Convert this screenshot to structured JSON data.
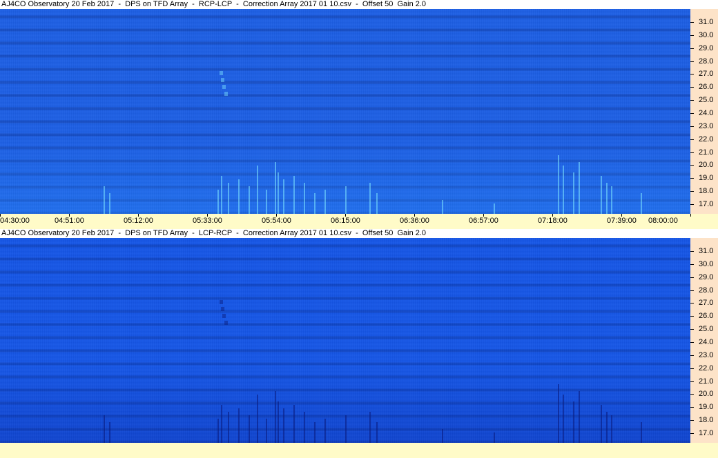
{
  "panels": [
    {
      "title": "AJ4CO Observatory 20 Feb 2017  -  DPS on TFD Array  -  RCP-LCP  -  Correction Array 2017 01 10.csv  -  Offset 50  Gain 2.0"
    },
    {
      "title": "AJ4CO Observatory 20 Feb 2017  -  DPS on TFD Array  -  LCP-RCP  -  Correction Array 2017 01 10.csv  -  Offset 50  Gain 2.0"
    }
  ],
  "freq_labels": [
    "31.0",
    "30.0",
    "29.0",
    "28.0",
    "27.0",
    "26.0",
    "25.0",
    "24.0",
    "23.0",
    "22.0",
    "21.0",
    "20.0",
    "19.0",
    "18.0",
    "17.0"
  ],
  "time_labels": [
    "04:30:00",
    "04:51:00",
    "05:12:00",
    "05:33:00",
    "05:54:00",
    "06:15:00",
    "06:36:00",
    "06:57:00",
    "07:18:00",
    "07:39:00",
    "08:00:00"
  ],
  "colors": {
    "panel_bg": "#1d5fe4",
    "freq_axis_bg": "#fde3c8",
    "time_axis_bg": "#fffbc8",
    "burst_bright": "#7fe8ff",
    "burst_dark": "#0a1d80"
  }
}
